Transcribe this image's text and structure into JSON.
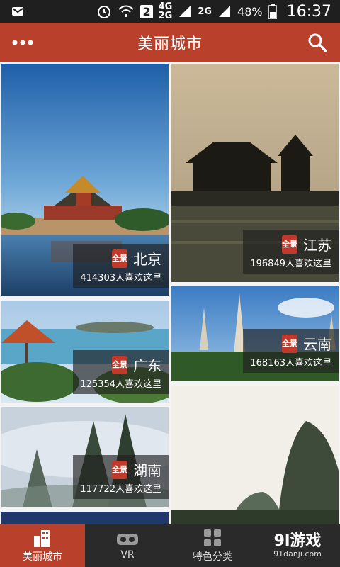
{
  "status_bar": {
    "badge": "2",
    "net_top": "4G",
    "net_bottom": "2G",
    "net2": "2G",
    "battery": "48%",
    "time": "16:37"
  },
  "app_bar": {
    "title": "美丽城市"
  },
  "cards": [
    {
      "city": "北京",
      "likes": "414303人喜欢这里"
    },
    {
      "city": "江苏",
      "likes": "196849人喜欢这里"
    },
    {
      "city": "广东",
      "likes": "125354人喜欢这里"
    },
    {
      "city": "云南",
      "likes": "168163人喜欢这里"
    },
    {
      "city": "湖南",
      "likes": "117722人喜欢这里"
    }
  ],
  "seal_text": "全景",
  "bottom_nav": [
    {
      "label": "美丽城市"
    },
    {
      "label": "VR"
    },
    {
      "label": "特色分类"
    }
  ],
  "watermark": {
    "big": "9l游戏",
    "small": "91danji.com"
  },
  "colors": {
    "accent": "#b9412b",
    "nav_bg": "#2a2a2a"
  }
}
